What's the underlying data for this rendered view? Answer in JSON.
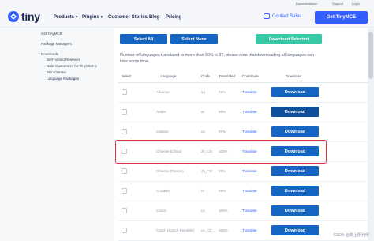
{
  "utility_bar": {
    "links": [
      "Documentation",
      "Support",
      "Login"
    ]
  },
  "header": {
    "logo_text": "tiny",
    "nav": [
      {
        "label": "Products",
        "has_dropdown": true
      },
      {
        "label": "Plugins",
        "has_dropdown": true
      },
      {
        "label": "Customer Stories",
        "has_dropdown": false
      },
      {
        "label": "Blog",
        "has_dropdown": false
      },
      {
        "label": "Pricing",
        "has_dropdown": false
      }
    ],
    "contact_label": "Contact Sales",
    "cta_label": "Get TinyMCE"
  },
  "sidebar": {
    "items": [
      "Get TinyMCE",
      "Package Managers",
      "Downloads",
      "Self-hosted Releases",
      "Build Customizer for TinyMCE 4",
      "Skin Creator",
      "Language Packages"
    ]
  },
  "actions": {
    "select_all": "Select All",
    "select_none": "Select None",
    "download_selected": "Download Selected"
  },
  "note": "Number of languages translated to more than 90% is 37, please note that downloading all languages can take some time.",
  "table": {
    "headers": [
      "Select",
      "Language",
      "Code",
      "Translated",
      "Contribute",
      "Download"
    ],
    "rows": [
      {
        "language": "Albanian",
        "code": "sq",
        "translated": "99%",
        "contribute": "Translate",
        "download": "Download"
      },
      {
        "language": "Arabic",
        "code": "ar",
        "translated": "99%",
        "contribute": "Translate",
        "download": "Download"
      },
      {
        "language": "Catalan",
        "code": "ca",
        "translated": "97%",
        "contribute": "Translate",
        "download": "Download"
      },
      {
        "language": "Chinese (China)",
        "code": "zh_CN",
        "translated": "100%",
        "contribute": "Translate",
        "download": "Download"
      },
      {
        "language": "Chinese (Taiwan)",
        "code": "zh_TW",
        "translated": "99%",
        "contribute": "Translate",
        "download": "Download"
      },
      {
        "language": "Croatian",
        "code": "hr",
        "translated": "99%",
        "contribute": "Translate",
        "download": "Download"
      },
      {
        "language": "Czech",
        "code": "cs",
        "translated": "100%",
        "contribute": "Translate",
        "download": "Download"
      },
      {
        "language": "Czech (Czech Republic)",
        "code": "cs_CZ",
        "translated": "100%",
        "contribute": "Translate",
        "download": "Download"
      }
    ]
  },
  "watermark": "CSDN @路上阳光呀",
  "colors": {
    "primary": "#335dff",
    "download": "#1466c2",
    "download_selected": "#37c8a5",
    "highlight": "#e5322d"
  }
}
